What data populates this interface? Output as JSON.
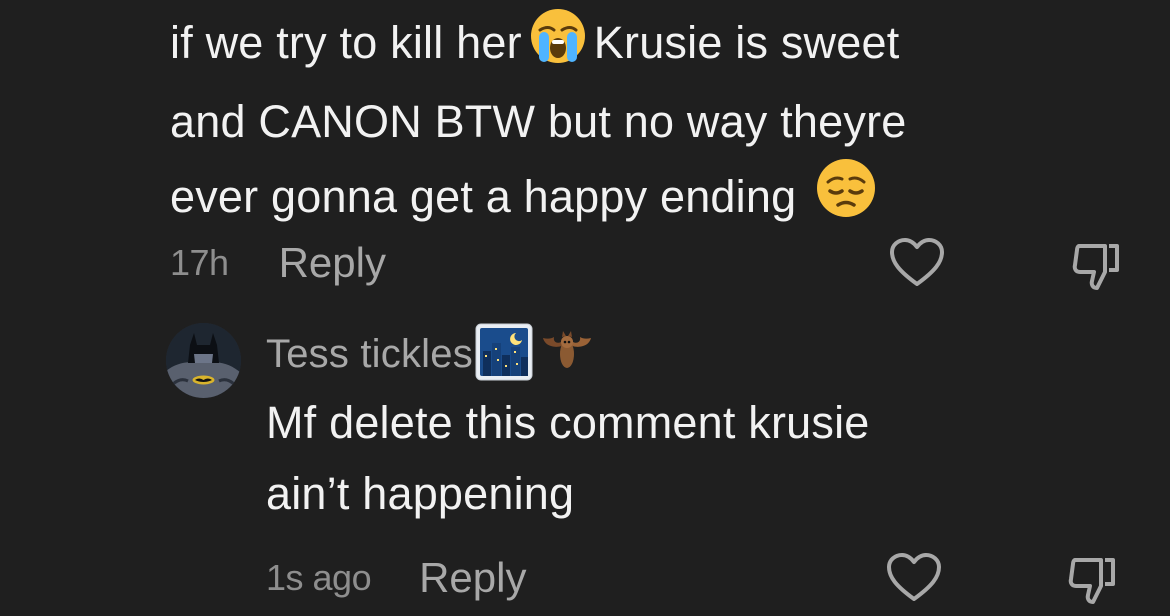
{
  "comment1": {
    "text_line1_part1": "if we try to kill her",
    "text_line1_emoji": "loudly-crying-face-emoji",
    "text_line1_part2": "Krusie is sweet",
    "text_line2": "and CANON BTW but no way theyre",
    "text_line3": "ever gonna get a happy ending",
    "text_line3_emoji": "pensive-face-emoji",
    "timestamp": "17h",
    "reply_label": "Reply",
    "like_icon": "heart-icon",
    "dislike_icon": "thumbs-down-icon"
  },
  "comment2": {
    "avatar": "batman-avatar",
    "username": "Tess tickles",
    "username_badges": [
      "night-city-emoji",
      "bat-emoji"
    ],
    "text_line1": "Mf delete this comment krusie",
    "text_line2": "ain’t happening",
    "timestamp": "1s ago",
    "reply_label": "Reply",
    "like_icon": "heart-icon",
    "dislike_icon": "thumbs-down-icon"
  },
  "colors": {
    "background": "#1f1f1f",
    "primary_text": "#f2f2f2",
    "secondary_text": "#a8a8a8",
    "timestamp_text": "#8e8e8e"
  }
}
